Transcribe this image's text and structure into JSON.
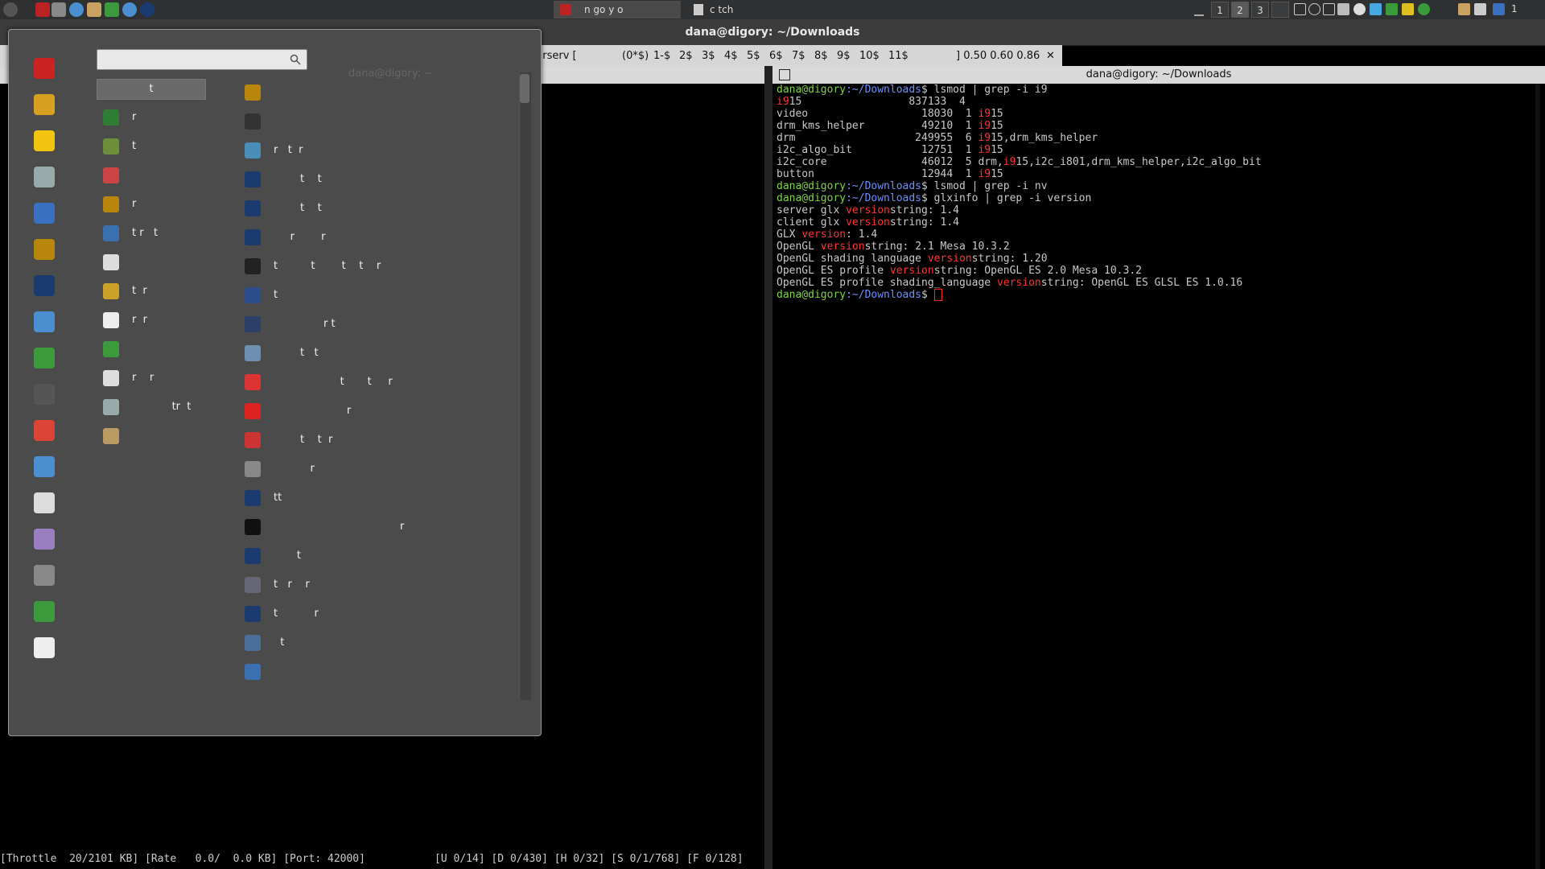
{
  "panel": {
    "tasks": [
      "n      go y      o",
      "c   tch"
    ],
    "workspaces": [
      "1",
      "2",
      "3",
      ""
    ],
    "tray_end": "1"
  },
  "window": {
    "title": "dana@digory: ~/Downloads"
  },
  "tmux": {
    "items": [
      "drserv [",
      "(0*$)",
      "1-$",
      "2$",
      "3$",
      "4$",
      "5$",
      "6$",
      "7$",
      "8$",
      "9$",
      "10$",
      "11$",
      "] 0.50 0.60 0.86",
      "✕"
    ]
  },
  "left_pane": {
    "header_ghost": "dana@digory: ~",
    "status": "[Throttle  20/2101 KB] [Rate   0.0/  0.0 KB] [Port: 42000]           [U 0/14] [D 0/430] [H 0/32] [S 0/1/768] [F 0/128]"
  },
  "right_pane": {
    "header": "dana@digory: ~/Downloads",
    "prompt_user": "dana@digory",
    "prompt_path": ":~/Downloads",
    "lines": [
      {
        "prompt": true,
        "cmd": " lsmod | grep -i i9"
      },
      {
        "segs": [
          [
            "red",
            "i9"
          ],
          [
            "",
            "15                 837133  4"
          ]
        ]
      },
      {
        "segs": [
          [
            "",
            "video                  18030  1 "
          ],
          [
            "red",
            "i9"
          ],
          [
            "",
            "15"
          ]
        ]
      },
      {
        "segs": [
          [
            "",
            "drm_kms_helper         49210  1 "
          ],
          [
            "red",
            "i9"
          ],
          [
            "",
            "15"
          ]
        ]
      },
      {
        "segs": [
          [
            "",
            "drm                   249955  6 "
          ],
          [
            "red",
            "i9"
          ],
          [
            "",
            "15,drm_kms_helper"
          ]
        ]
      },
      {
        "segs": [
          [
            "",
            "i2c_algo_bit           12751  1 "
          ],
          [
            "red",
            "i9"
          ],
          [
            "",
            "15"
          ]
        ]
      },
      {
        "segs": [
          [
            "",
            "i2c_core               46012  5 drm,"
          ],
          [
            "red",
            "i9"
          ],
          [
            "",
            "15,i2c_i801,drm_kms_helper,i2c_algo_bit"
          ]
        ]
      },
      {
        "segs": [
          [
            "",
            "button                 12944  1 "
          ],
          [
            "red",
            "i9"
          ],
          [
            "",
            "15"
          ]
        ]
      },
      {
        "prompt": true,
        "cmd": " lsmod | grep -i nv"
      },
      {
        "prompt": true,
        "cmd": " glxinfo | grep -i version"
      },
      {
        "segs": [
          [
            "",
            "server glx "
          ],
          [
            "red",
            "version"
          ],
          [
            "",
            ""
          ],
          [
            "",
            "string: 1.4"
          ]
        ]
      },
      {
        "segs": [
          [
            "",
            "client glx "
          ],
          [
            "red",
            "version"
          ],
          [
            "",
            ""
          ],
          [
            "",
            "string: 1.4"
          ]
        ]
      },
      {
        "segs": [
          [
            "",
            "GLX "
          ],
          [
            "red",
            "version"
          ],
          [
            "",
            ""
          ],
          [
            "",
            ": 1.4"
          ]
        ]
      },
      {
        "segs": [
          [
            "",
            "OpenGL "
          ],
          [
            "red",
            "version"
          ],
          [
            "",
            "string: 2.1 Mesa 10.3.2"
          ]
        ]
      },
      {
        "segs": [
          [
            "",
            "OpenGL shading language "
          ],
          [
            "red",
            "version"
          ],
          [
            "",
            ""
          ],
          [
            "",
            "string: 1.20"
          ]
        ]
      },
      {
        "segs": [
          [
            "",
            "OpenGL ES profile "
          ],
          [
            "red",
            "version"
          ],
          [
            "",
            ""
          ],
          [
            "",
            "string: OpenGL ES 2.0 Mesa 10.3.2"
          ]
        ]
      },
      {
        "segs": [
          [
            "",
            "OpenGL ES profile shading_language "
          ],
          [
            "red",
            "version"
          ],
          [
            "",
            ""
          ],
          [
            "",
            "string: OpenGL ES GLSL ES 1.0.16"
          ]
        ]
      },
      {
        "prompt": true,
        "cmd": " ",
        "cursor": true
      }
    ]
  },
  "menu": {
    "search_placeholder": "",
    "ghost_tab": "dana@digory: ~",
    "selected_tab": "t",
    "col1": [
      {
        "label": "r",
        "color": "#2e7d32"
      },
      {
        "label": "t",
        "color": "#6d8f3a"
      },
      {
        "label": "",
        "color": "#c44"
      },
      {
        "label": "r",
        "color": "#b8860b"
      },
      {
        "label": "t r   t",
        "color": "#3a6fb0"
      },
      {
        "label": "",
        "color": "#ddd"
      },
      {
        "label": "t  r",
        "color": "#c9a227"
      },
      {
        "label": "r  r",
        "color": "#eee"
      },
      {
        "label": "",
        "color": "#3b9a3b"
      },
      {
        "label": "r    r",
        "color": "#ddd"
      },
      {
        "label": "            tr  t",
        "color": "#9aa"
      },
      {
        "label": "",
        "color": "#b89a62"
      }
    ],
    "col2": [
      {
        "label": "",
        "color": "#b8860b"
      },
      {
        "label": "",
        "color": "#333"
      },
      {
        "label": "r   t  r",
        "color": "#4a8db7"
      },
      {
        "label": "        t    t",
        "color": "#1b3b6f"
      },
      {
        "label": "        t    t",
        "color": "#1b3b6f"
      },
      {
        "label": "     r        r",
        "color": "#1b3b6f"
      },
      {
        "label": "t          t        t    t    r",
        "color": "#222"
      },
      {
        "label": "t",
        "color": "#2b4d8a"
      },
      {
        "label": "               r t",
        "color": "#2a3f6a"
      },
      {
        "label": "        t   t",
        "color": "#6f8fb0"
      },
      {
        "label": "                    t       t     r",
        "color": "#d33"
      },
      {
        "label": "                      r",
        "color": "#d22"
      },
      {
        "label": "        t    t  r",
        "color": "#c33"
      },
      {
        "label": "           r",
        "color": "#888"
      },
      {
        "label": "tt",
        "color": "#1b3b6f"
      },
      {
        "label": "                                      r",
        "color": "#111"
      },
      {
        "label": "       t",
        "color": "#1b3b6f"
      },
      {
        "label": "t   r    r",
        "color": "#667"
      },
      {
        "label": "t           r",
        "color": "#1b3b6f"
      },
      {
        "label": "  t",
        "color": "#4a6f9a"
      },
      {
        "label": "",
        "color": "#3a6fb0"
      }
    ],
    "categories": [
      "#c22",
      "#d8a020",
      "#f1c40f",
      "#9aa",
      "#3a70c0",
      "#b8860b",
      "#1b3b6f",
      "#4a8fd0",
      "#3b9a3b",
      "#555",
      "#db4437",
      "#4a8fd0",
      "#ddd",
      "#9a7fc0",
      "#888",
      "#3b9a3b",
      "#eee"
    ]
  }
}
